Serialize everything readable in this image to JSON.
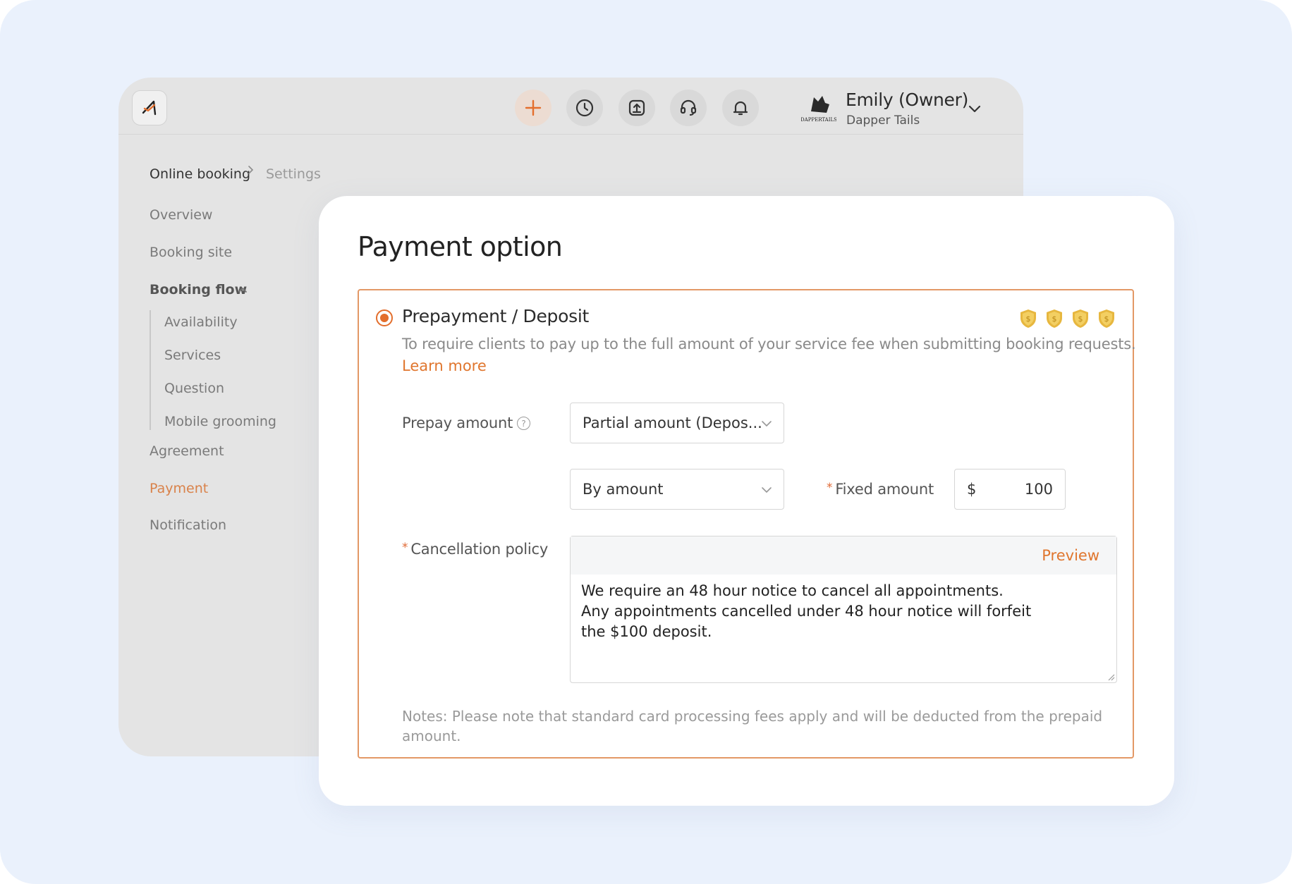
{
  "header": {
    "user_name": "Emily (Owner)",
    "business_name": "Dapper Tails",
    "actions": [
      "add-icon",
      "clock-icon",
      "upload-icon",
      "headset-icon",
      "bell-icon"
    ],
    "accent_color": "#e36e2c"
  },
  "breadcrumb": {
    "current": "Online booking",
    "next": "Settings"
  },
  "sidebar": {
    "items": [
      {
        "label": "Overview"
      },
      {
        "label": "Booking site"
      },
      {
        "label": "Booking flow"
      },
      {
        "label": "Availability"
      },
      {
        "label": "Services"
      },
      {
        "label": "Question"
      },
      {
        "label": "Mobile grooming"
      },
      {
        "label": "Agreement"
      },
      {
        "label": "Payment"
      },
      {
        "label": "Notification"
      }
    ],
    "active": "Payment"
  },
  "card": {
    "title": "Payment option",
    "option": {
      "title": "Prepayment / Deposit",
      "selected": true,
      "description": "To require clients to pay up to the full amount of your service fee when submitting booking requests.",
      "learn_more": "Learn more",
      "prepay_label": "Prepay amount",
      "prepay_value": "Partial amount (Depos...",
      "method_value": "By amount",
      "fixed_label": "Fixed amount",
      "currency": "$",
      "amount": "100",
      "policy_label": "Cancellation policy",
      "preview_label": "Preview",
      "policy_text": "We require an 48 hour notice to cancel all appointments.\nAny appointments cancelled under 48 hour notice will forfeit\nthe $100 deposit.",
      "notes": "Notes: Please note that standard card processing fees apply and will be deducted from the prepaid amount."
    }
  }
}
